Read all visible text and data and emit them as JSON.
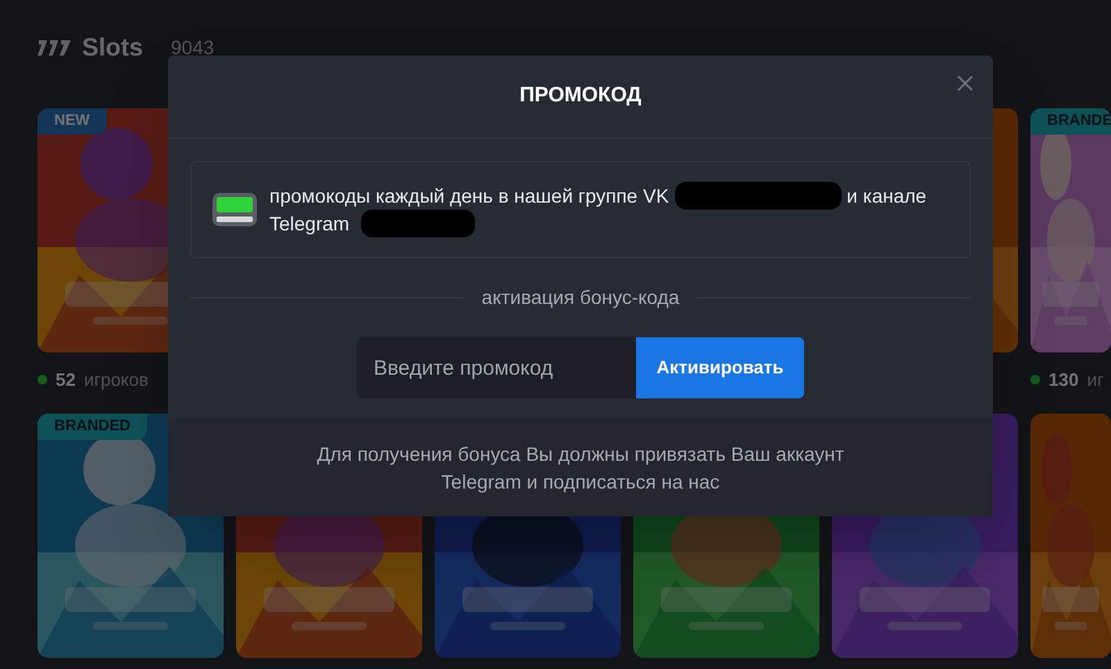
{
  "section": {
    "title": "Slots",
    "count": "9043"
  },
  "game_rows": [
    [
      {
        "kind": "game",
        "badge": "NEW",
        "players_count": "52",
        "players_label": "игроков"
      },
      {
        "kind": "covered"
      },
      {
        "kind": "covered"
      },
      {
        "kind": "covered"
      },
      {
        "kind": "game"
      },
      {
        "kind": "game",
        "badge": "BRANDE",
        "players_count": "130",
        "players_label": "иг"
      }
    ],
    [
      {
        "kind": "game",
        "badge": "BRANDED"
      },
      {
        "kind": "game_under_modal"
      },
      {
        "kind": "game_under_modal"
      },
      {
        "kind": "game_under_modal"
      },
      {
        "kind": "game"
      },
      {
        "kind": "game"
      }
    ]
  ],
  "modal": {
    "title": "ПРОМОКОД",
    "info_lines": [
      [
        {
          "kind": "text",
          "text": "промокоды каждый день в нашей группе VK"
        },
        {
          "kind": "redacted"
        },
        {
          "kind": "text",
          "text": "и канале"
        }
      ],
      [
        {
          "kind": "text",
          "text": "Telegram"
        },
        {
          "kind": "redacted_short"
        }
      ]
    ],
    "divider_label": "активация бонус-кода",
    "code_field": {
      "placeholder": "Введите промокод"
    },
    "activate_button": "Активировать",
    "footer_note": "Для получения бонуса Вы должны привязать Ваш аккаунт Telegram и подписаться на нас"
  }
}
